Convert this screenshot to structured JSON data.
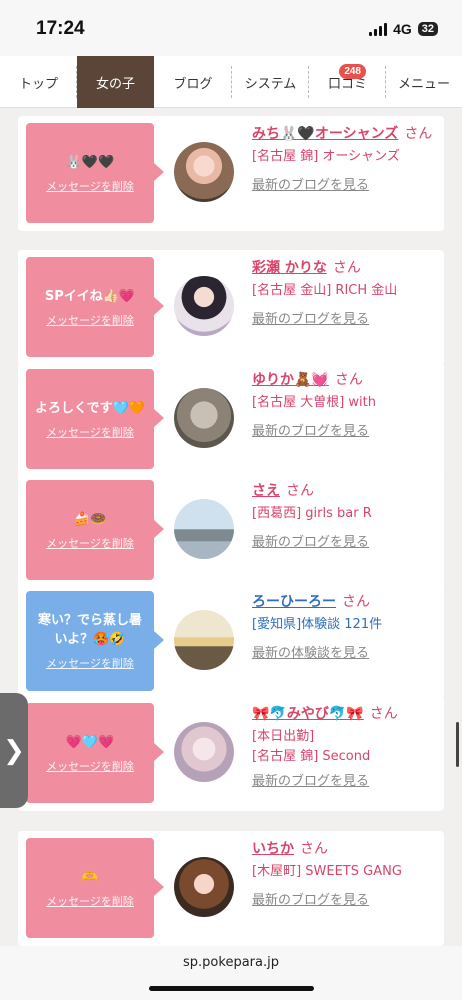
{
  "status_bar": {
    "time": "17:24",
    "network": "4G",
    "battery": "32"
  },
  "nav": {
    "tabs": [
      {
        "label": "トップ"
      },
      {
        "label": "女の子",
        "active": true
      },
      {
        "label": "ブログ"
      },
      {
        "label": "システム"
      },
      {
        "label": "口コミ",
        "badge": "248"
      },
      {
        "label": "メニュー"
      }
    ]
  },
  "colors": {
    "nav_active": "#5a4538",
    "bubble_pink": "#f08ea0",
    "bubble_blue": "#7aaee8",
    "name_pink": "#d9446b",
    "name_blue": "#2e6fbb",
    "badge": "#e8524e"
  },
  "items": [
    {
      "message": "🐰🖤🖤",
      "delete_label": "メッセージを削除",
      "name": "みち🐰🖤オーシャンズ",
      "honorific": "さん",
      "lines": [
        "[名古屋 錦] オーシャンズ"
      ],
      "link": "最新のブログを見る",
      "style": "pink"
    },
    {
      "message": "SPイイね👍🏻💗",
      "delete_label": "メッセージを削除",
      "name": "彩瀬 かりな",
      "honorific": "さん",
      "lines": [
        "[名古屋 金山] RICH 金山"
      ],
      "link": "最新のブログを見る",
      "style": "pink"
    },
    {
      "message": "よろしくです🩵🧡",
      "delete_label": "メッセージを削除",
      "name": "ゆりか🧸💓",
      "honorific": "さん",
      "lines": [
        "[名古屋 大曽根] with"
      ],
      "link": "最新のブログを見る",
      "style": "pink"
    },
    {
      "message": "🍰🍩",
      "delete_label": "メッセージを削除",
      "name": "さえ",
      "honorific": "さん",
      "lines": [
        "[西葛西] girls bar R"
      ],
      "link": "最新のブログを見る",
      "style": "pink"
    },
    {
      "message": "寒い？でら蒸し暑いよ？🥵🤣",
      "delete_label": "メッセージを削除",
      "name": "ろーひーろー",
      "honorific": "さん",
      "lines": [
        "[愛知県]体験談 121件"
      ],
      "link": "最新の体験談を見る",
      "style": "blue"
    },
    {
      "message": "💗🩵💗",
      "delete_label": "メッセージを削除",
      "name": "🎀🐬みやび🐬🎀",
      "honorific": "さん",
      "lines": [
        "[本日出勤]",
        "[名古屋 錦] Second"
      ],
      "link": "最新のブログを見る",
      "style": "pink"
    },
    {
      "message": "🫶",
      "delete_label": "メッセージを削除",
      "name": "いちか",
      "honorific": "さん",
      "lines": [
        "[木屋町] SWEETS GANG"
      ],
      "link": "最新のブログを見る",
      "style": "pink"
    }
  ],
  "url_bar": {
    "url": "sp.pokepara.jp"
  },
  "side_handle": {
    "icon": "chevron-right-icon",
    "glyph": "❯"
  }
}
